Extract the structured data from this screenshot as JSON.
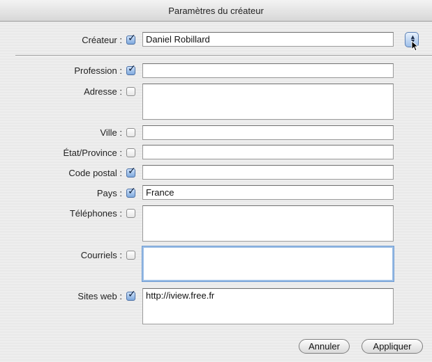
{
  "window": {
    "title": "Paramètres du créateur"
  },
  "fields": {
    "createur": {
      "label": "Créateur :",
      "checked": true,
      "value": "Daniel Robillard"
    },
    "profession": {
      "label": "Profession :",
      "checked": true,
      "value": ""
    },
    "adresse": {
      "label": "Adresse :",
      "checked": false,
      "value": ""
    },
    "ville": {
      "label": "Ville :",
      "checked": false,
      "value": ""
    },
    "etat": {
      "label": "État/Province :",
      "checked": false,
      "value": ""
    },
    "code_postal": {
      "label": "Code postal :",
      "checked": true,
      "value": ""
    },
    "pays": {
      "label": "Pays :",
      "checked": true,
      "value": "France"
    },
    "telephones": {
      "label": "Téléphones :",
      "checked": false,
      "value": ""
    },
    "courriels": {
      "label": "Courriels :",
      "checked": false,
      "value": ""
    },
    "sites_web": {
      "label": "Sites web :",
      "checked": true,
      "value": "http://iview.free.fr"
    }
  },
  "buttons": {
    "cancel": "Annuler",
    "apply": "Appliquer"
  },
  "icons": {
    "stepper": "stepper-icon",
    "cursor": "pointer-cursor-icon",
    "checkbox_checked": "checkmark-icon"
  }
}
